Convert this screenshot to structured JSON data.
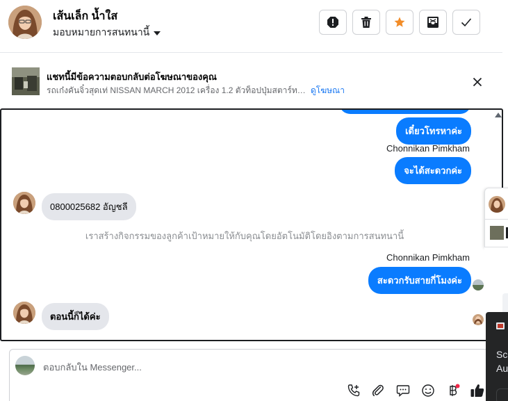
{
  "header": {
    "contact_name": "เส้นเล็ก น้ำใส",
    "assign_label": "มอบหมายการสนทนานี้",
    "actions": [
      {
        "name": "report-spam-button",
        "icon": "alert-octagon-icon"
      },
      {
        "name": "delete-button",
        "icon": "trash-icon"
      },
      {
        "name": "follow-up-button",
        "icon": "star-icon"
      },
      {
        "name": "move-to-archive-button",
        "icon": "archive-icon"
      },
      {
        "name": "mark-done-button",
        "icon": "check-icon"
      }
    ],
    "star_color": "#f28c28"
  },
  "ad_banner": {
    "title": "แชทนี้มีข้อความตอบกลับต่อโฆษณาของคุณ",
    "subtitle": "รถเก๋งคันจิ๋วสุดเท่ NISSAN MARCH 2012 เครื่อง 1.2 ตัวท็อปปุ่มสตาร์ท ผ่อนสบาย",
    "link_label": "ดูโฆษณา"
  },
  "messages": {
    "m1": "เดี๋ยวโทรหาค่ะ",
    "sender1": "Chonnikan Pimkham",
    "m2": "จะได้สะดวกค่ะ",
    "m3": "0800025682 อัญชลี",
    "system_note": "เราสร้างกิจกรรมของลูกค้าเป้าหมายให้กับคุณโดยอัตโนมัติโดยอิงตามการสนทนานี้",
    "sender2": "Chonnikan Pimkham",
    "m4": "สะดวกรับสายกี่โมงค่ะ",
    "m5": "ตอนนี้ก็ได้ค่ะ"
  },
  "composer": {
    "placeholder": "ตอบกลับใน Messenger..."
  },
  "side_popup": {
    "text_line1": "Scr",
    "text_line2": "Au"
  },
  "colors": {
    "outgoing_bubble": "#0a7cff",
    "incoming_bubble": "#e4e6eb",
    "link": "#1877f2"
  }
}
